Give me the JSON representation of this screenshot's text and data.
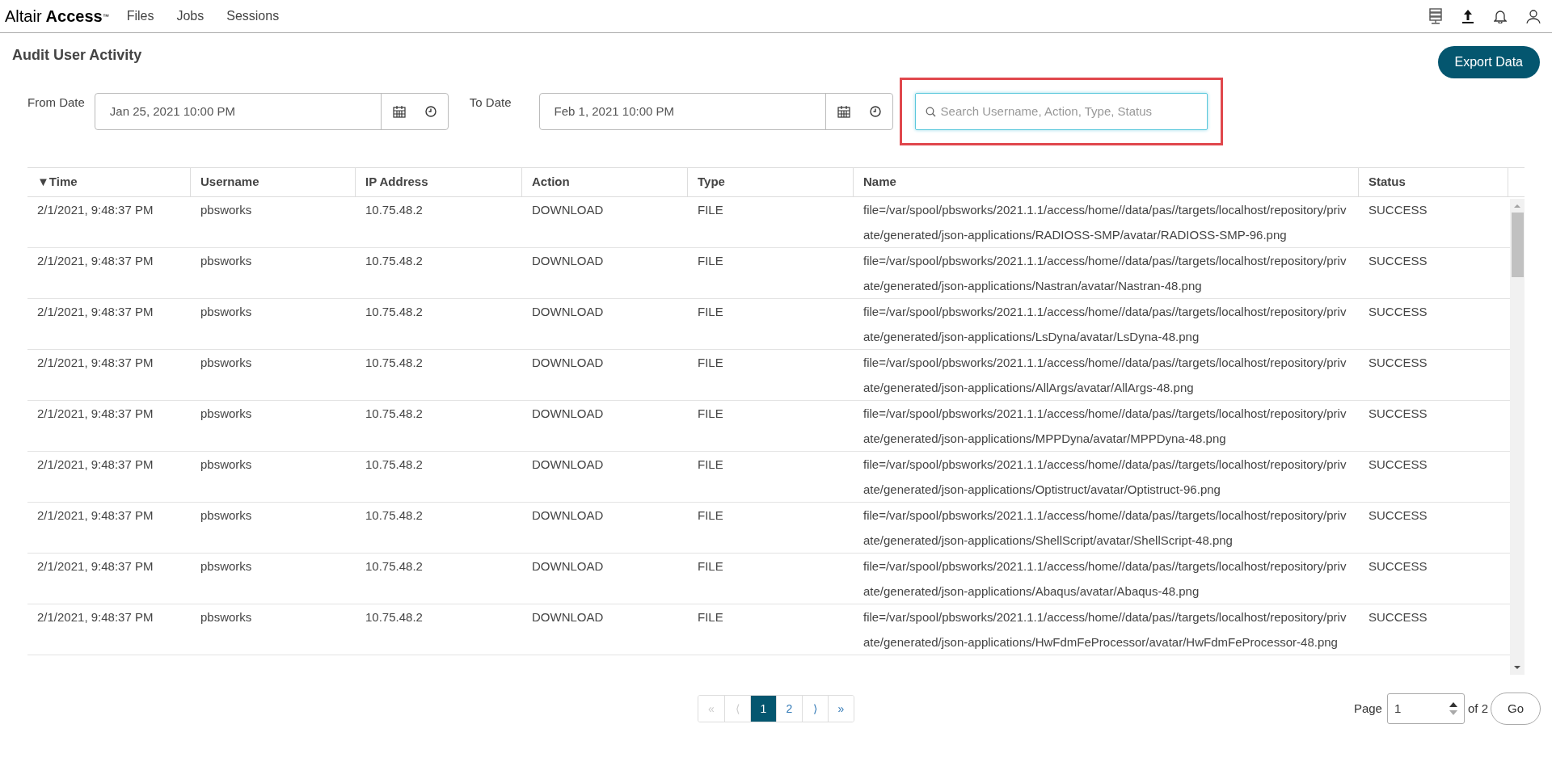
{
  "header": {
    "logo_light": "Altair",
    "logo_bold": "Access",
    "logo_mark": "™",
    "nav": [
      {
        "label": "Files"
      },
      {
        "label": "Jobs"
      },
      {
        "label": "Sessions"
      }
    ]
  },
  "page_title": "Audit User Activity",
  "export_button": "Export Data",
  "filters": {
    "from_label": "From Date",
    "from_value": "Jan 25, 2021 10:00 PM",
    "to_label": "To Date",
    "to_value": "Feb 1, 2021 10:00 PM",
    "search_placeholder": "Search Username, Action, Type, Status",
    "search_highlighted": true
  },
  "table": {
    "columns": [
      {
        "label": "Time",
        "sort_icon": "▼"
      },
      {
        "label": "Username"
      },
      {
        "label": "IP Address"
      },
      {
        "label": "Action"
      },
      {
        "label": "Type"
      },
      {
        "label": "Name"
      },
      {
        "label": "Status"
      }
    ],
    "rows": [
      [
        "2/1/2021, 9:48:37 PM",
        "pbsworks",
        "10.75.48.2",
        "DOWNLOAD",
        "FILE",
        "file=/var/spool/pbsworks/2021.1.1/access/home//data/pas//targets/localhost/repository/private/generated/json-applications/RADIOSS-SMP/avatar/RADIOSS-SMP-96.png",
        "SUCCESS"
      ],
      [
        "2/1/2021, 9:48:37 PM",
        "pbsworks",
        "10.75.48.2",
        "DOWNLOAD",
        "FILE",
        "file=/var/spool/pbsworks/2021.1.1/access/home//data/pas//targets/localhost/repository/private/generated/json-applications/Nastran/avatar/Nastran-48.png",
        "SUCCESS"
      ],
      [
        "2/1/2021, 9:48:37 PM",
        "pbsworks",
        "10.75.48.2",
        "DOWNLOAD",
        "FILE",
        "file=/var/spool/pbsworks/2021.1.1/access/home//data/pas//targets/localhost/repository/private/generated/json-applications/LsDyna/avatar/LsDyna-48.png",
        "SUCCESS"
      ],
      [
        "2/1/2021, 9:48:37 PM",
        "pbsworks",
        "10.75.48.2",
        "DOWNLOAD",
        "FILE",
        "file=/var/spool/pbsworks/2021.1.1/access/home//data/pas//targets/localhost/repository/private/generated/json-applications/AllArgs/avatar/AllArgs-48.png",
        "SUCCESS"
      ],
      [
        "2/1/2021, 9:48:37 PM",
        "pbsworks",
        "10.75.48.2",
        "DOWNLOAD",
        "FILE",
        "file=/var/spool/pbsworks/2021.1.1/access/home//data/pas//targets/localhost/repository/private/generated/json-applications/MPPDyna/avatar/MPPDyna-48.png",
        "SUCCESS"
      ],
      [
        "2/1/2021, 9:48:37 PM",
        "pbsworks",
        "10.75.48.2",
        "DOWNLOAD",
        "FILE",
        "file=/var/spool/pbsworks/2021.1.1/access/home//data/pas//targets/localhost/repository/private/generated/json-applications/Optistruct/avatar/Optistruct-96.png",
        "SUCCESS"
      ],
      [
        "2/1/2021, 9:48:37 PM",
        "pbsworks",
        "10.75.48.2",
        "DOWNLOAD",
        "FILE",
        "file=/var/spool/pbsworks/2021.1.1/access/home//data/pas//targets/localhost/repository/private/generated/json-applications/ShellScript/avatar/ShellScript-48.png",
        "SUCCESS"
      ],
      [
        "2/1/2021, 9:48:37 PM",
        "pbsworks",
        "10.75.48.2",
        "DOWNLOAD",
        "FILE",
        "file=/var/spool/pbsworks/2021.1.1/access/home//data/pas//targets/localhost/repository/private/generated/json-applications/Abaqus/avatar/Abaqus-48.png",
        "SUCCESS"
      ],
      [
        "2/1/2021, 9:48:37 PM",
        "pbsworks",
        "10.75.48.2",
        "DOWNLOAD",
        "FILE",
        "file=/var/spool/pbsworks/2021.1.1/access/home//data/pas//targets/localhost/repository/private/generated/json-applications/HwFdmFeProcessor/avatar/HwFdmFeProcessor-48.png",
        "SUCCESS"
      ]
    ]
  },
  "pagination": {
    "buttons": [
      {
        "label": "«",
        "disabled": true,
        "selected": false
      },
      {
        "label": "⟨",
        "disabled": true,
        "selected": false
      },
      {
        "label": "1",
        "disabled": false,
        "selected": true
      },
      {
        "label": "2",
        "disabled": false,
        "selected": false
      },
      {
        "label": "⟩",
        "disabled": false,
        "selected": false
      },
      {
        "label": "»",
        "disabled": false,
        "selected": false
      }
    ],
    "page_label": "Page",
    "page_value": "1",
    "of_label": "of 2",
    "go_button": "Go"
  }
}
